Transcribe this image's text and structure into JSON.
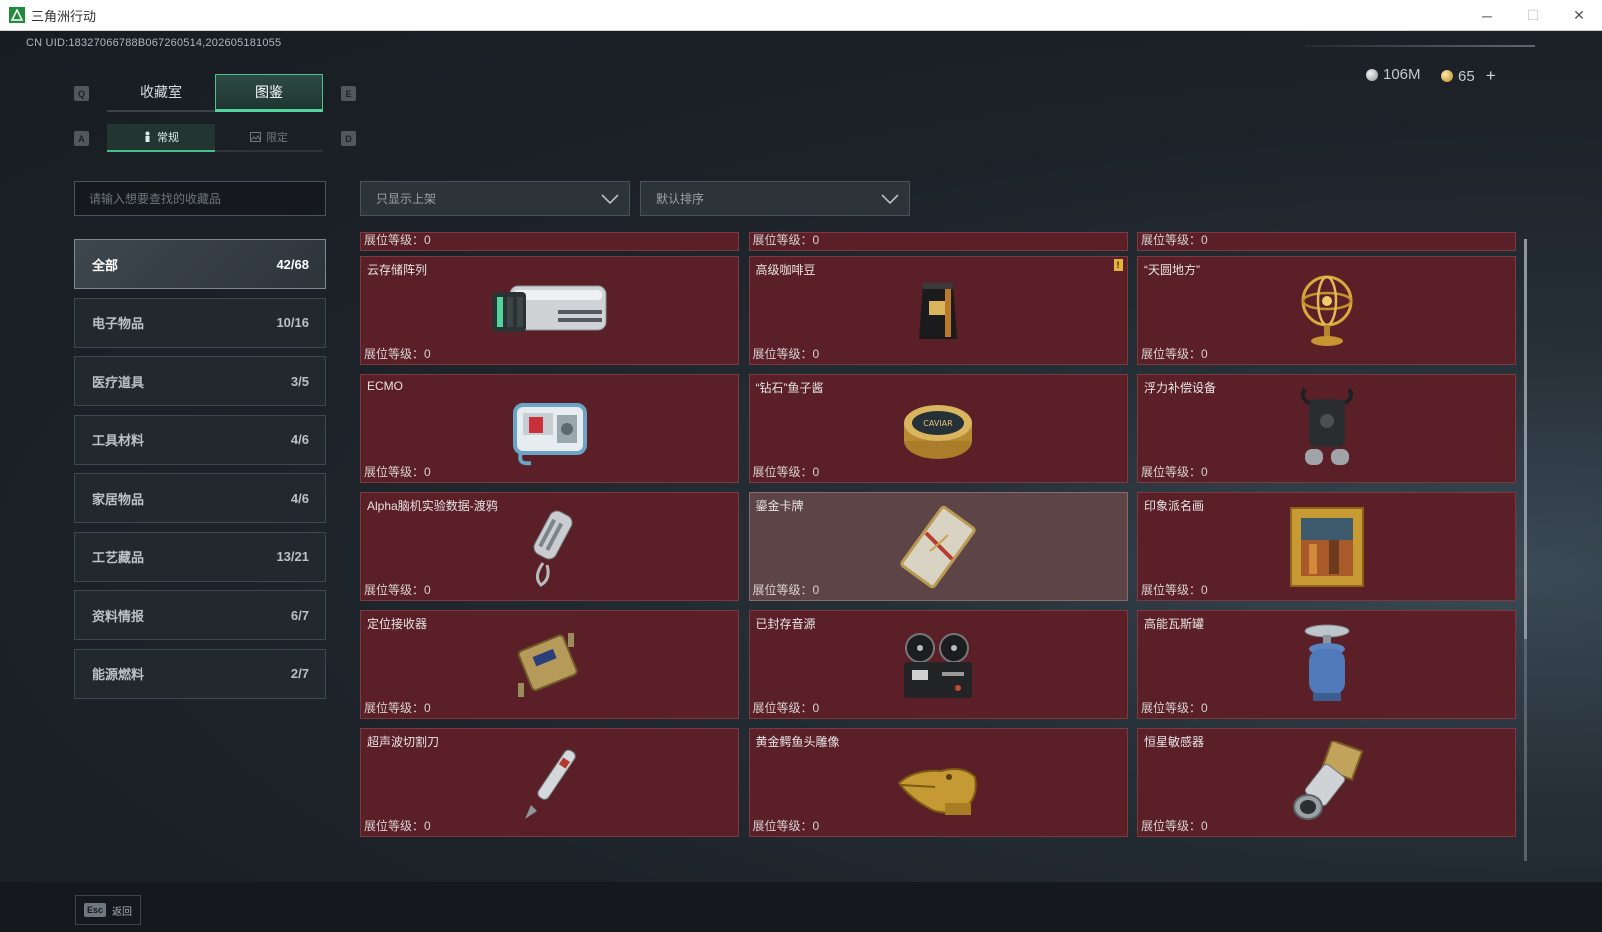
{
  "window": {
    "title": "三角洲行动",
    "minimize": "─",
    "maximize": "☐",
    "close": "✕"
  },
  "header": {
    "uid": "CN UID:18327066788B067260514,202605181055",
    "currency_silver": "106M",
    "currency_gold": "65",
    "add_symbol": "+"
  },
  "keys": {
    "q": "Q",
    "e": "E",
    "a": "A",
    "d": "D"
  },
  "tabs": [
    {
      "label": "收藏室"
    },
    {
      "label": "图鉴"
    }
  ],
  "subtabs": [
    {
      "label": "常规"
    },
    {
      "label": "限定"
    }
  ],
  "search": {
    "placeholder": "请输入想要查找的收藏品"
  },
  "filters": {
    "shelf": "只显示上架",
    "sort": "默认排序"
  },
  "categories": [
    {
      "label": "全部",
      "count": "42/68"
    },
    {
      "label": "电子物品",
      "count": "10/16"
    },
    {
      "label": "医疗道具",
      "count": "3/5"
    },
    {
      "label": "工具材料",
      "count": "4/6"
    },
    {
      "label": "家居物品",
      "count": "4/6"
    },
    {
      "label": "工艺藏品",
      "count": "13/21"
    },
    {
      "label": "资料情报",
      "count": "6/7"
    },
    {
      "label": "能源燃料",
      "count": "2/7"
    }
  ],
  "level_prefix": "展位等级：",
  "partial_row": [
    {
      "level": "0"
    },
    {
      "level": "0"
    },
    {
      "level": "0"
    }
  ],
  "items": [
    {
      "name": "云存储阵列",
      "level": "0",
      "icon": "server-array-icon"
    },
    {
      "name": "高级咖啡豆",
      "level": "0",
      "icon": "coffee-bag-icon",
      "badge": "!"
    },
    {
      "name": "“天圆地方”",
      "level": "0",
      "icon": "armillary-sphere-icon"
    },
    {
      "name": "ECMO",
      "level": "0",
      "icon": "ecmo-machine-icon"
    },
    {
      "name": "“钻石”鱼子酱",
      "level": "0",
      "icon": "caviar-tin-icon",
      "tin_label": "CAVIAR"
    },
    {
      "name": "浮力补偿设备",
      "level": "0",
      "icon": "buoyancy-device-icon"
    },
    {
      "name": "Alpha脑机实验数据-渡鸦",
      "level": "0",
      "icon": "data-capsule-icon"
    },
    {
      "name": "鎏金卡牌",
      "level": "0",
      "icon": "gilded-card-icon"
    },
    {
      "name": "印象派名画",
      "level": "0",
      "icon": "framed-painting-icon"
    },
    {
      "name": "定位接收器",
      "level": "0",
      "icon": "gps-receiver-icon"
    },
    {
      "name": "已封存音源",
      "level": "0",
      "icon": "reel-recorder-icon"
    },
    {
      "name": "高能瓦斯罐",
      "level": "0",
      "icon": "gas-canister-icon"
    },
    {
      "name": "超声波切割刀",
      "level": "0",
      "icon": "ultrasonic-cutter-icon"
    },
    {
      "name": "黄金鳄鱼头雕像",
      "level": "0",
      "icon": "golden-crocodile-icon"
    },
    {
      "name": "恒星敏感器",
      "level": "0",
      "icon": "star-sensor-icon"
    }
  ],
  "bottom": {
    "esc_key": "Esc",
    "back": "返回"
  },
  "colors": {
    "card_bg": "#5a1f27",
    "card_highlight": "#5d4447",
    "accent_green": "#52d49d"
  }
}
